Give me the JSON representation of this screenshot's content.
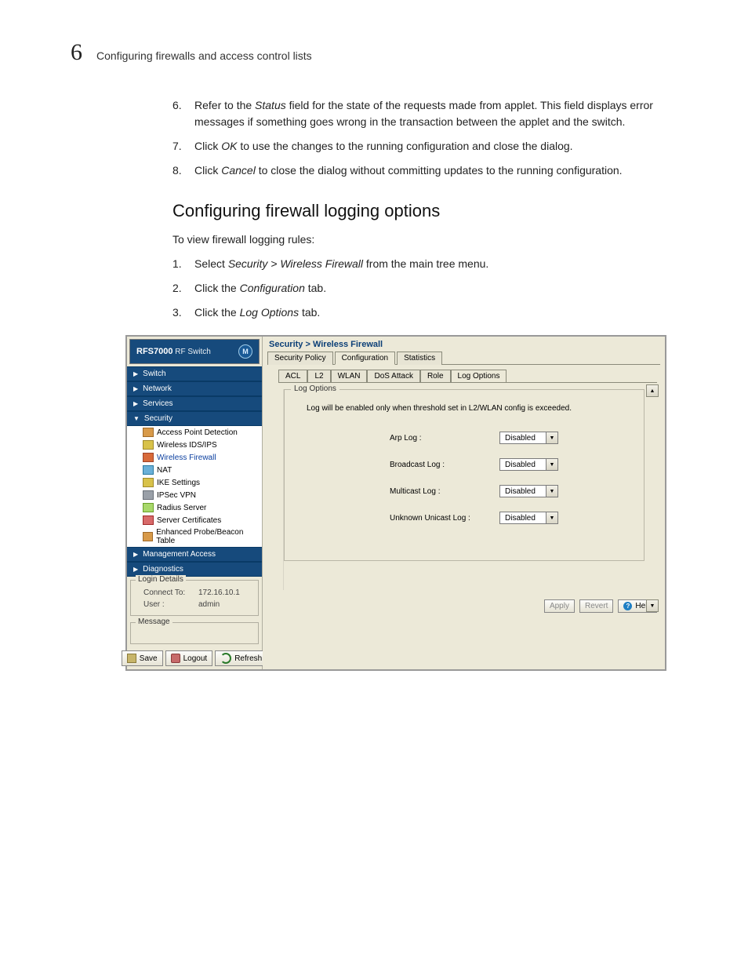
{
  "chapter": {
    "number": "6",
    "title": "Configuring firewalls and access control lists"
  },
  "steps_top": [
    {
      "n": "6.",
      "pre": "Refer to the ",
      "em": "Status",
      "post": " field for the state of the requests made from applet. This field displays error messages if something goes wrong in the transaction between the applet and the switch."
    },
    {
      "n": "7.",
      "pre": "Click ",
      "em": "OK",
      "post": " to use the changes to the running configuration and close the dialog."
    },
    {
      "n": "8.",
      "pre": "Click ",
      "em": "Cancel",
      "post": " to close the dialog without committing updates to the running configuration."
    }
  ],
  "section_title": "Configuring firewall logging options",
  "lead": "To view firewall logging rules:",
  "steps_mid": [
    {
      "n": "1.",
      "pre": "Select ",
      "em": "Security > Wireless Firewall",
      "post": " from the main tree menu."
    },
    {
      "n": "2.",
      "pre": "Click the ",
      "em": "Configuration",
      "post": " tab."
    },
    {
      "n": "3.",
      "pre": "Click the ",
      "em": "Log Options",
      "post": " tab."
    }
  ],
  "ui": {
    "brand": {
      "main": "RFS7000",
      "sub": "RF Switch",
      "logo_glyph": "M"
    },
    "nav_headers": [
      "Switch",
      "Network",
      "Services",
      "Security"
    ],
    "security_children": [
      "Access Point Detection",
      "Wireless IDS/IPS",
      "Wireless Firewall",
      "NAT",
      "IKE Settings",
      "IPSec VPN",
      "Radius Server",
      "Server Certificates",
      "Enhanced Probe/Beacon Table"
    ],
    "nav_footer": [
      "Management Access",
      "Diagnostics"
    ],
    "login": {
      "legend": "Login Details",
      "connect_label": "Connect To:",
      "connect_value": "172.16.10.1",
      "user_label": "User :",
      "user_value": "admin"
    },
    "message_legend": "Message",
    "left_buttons": {
      "save": "Save",
      "logout": "Logout",
      "refresh": "Refresh"
    },
    "breadcrumb": "Security > Wireless Firewall",
    "tabs": [
      "Security Policy",
      "Configuration",
      "Statistics"
    ],
    "active_tab": "Configuration",
    "subtabs": [
      "ACL",
      "L2",
      "WLAN",
      "DoS Attack",
      "Role",
      "Log Options"
    ],
    "active_subtab": "Log Options",
    "log": {
      "legend": "Log Options",
      "hint": "Log will be enabled only when threshold set in L2/WLAN config is exceeded.",
      "rows": [
        {
          "label": "Arp Log :",
          "value": "Disabled"
        },
        {
          "label": "Broadcast Log :",
          "value": "Disabled"
        },
        {
          "label": "Multicast Log :",
          "value": "Disabled"
        },
        {
          "label": "Unknown Unicast Log :",
          "value": "Disabled"
        }
      ]
    },
    "footer_buttons": {
      "apply": "Apply",
      "revert": "Revert",
      "help": "Help"
    }
  }
}
